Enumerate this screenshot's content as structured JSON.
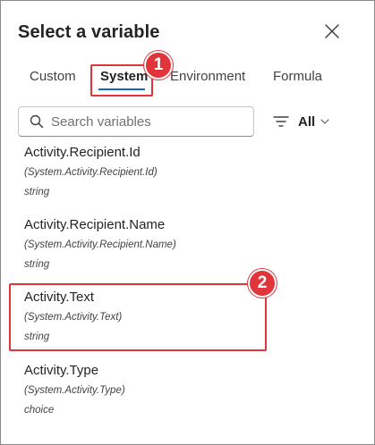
{
  "dialog": {
    "title": "Select a variable"
  },
  "tabs": [
    {
      "label": "Custom",
      "active": false
    },
    {
      "label": "System",
      "active": true
    },
    {
      "label": "Environment",
      "active": false
    },
    {
      "label": "Formula",
      "active": false
    }
  ],
  "search": {
    "placeholder": "Search variables",
    "value": ""
  },
  "filter": {
    "label": "All"
  },
  "variables": [
    {
      "name": "Activity.Recipient.Id",
      "path": "(System.Activity.Recipient.Id)",
      "type": "string"
    },
    {
      "name": "Activity.Recipient.Name",
      "path": "(System.Activity.Recipient.Name)",
      "type": "string"
    },
    {
      "name": "Activity.Text",
      "path": "(System.Activity.Text)",
      "type": "string"
    },
    {
      "name": "Activity.Type",
      "path": "(System.Activity.Type)",
      "type": "choice"
    }
  ],
  "callouts": [
    {
      "number": "1"
    },
    {
      "number": "2"
    }
  ],
  "colors": {
    "callout": "#e0353b",
    "active_tab_underline": "#0f6cbd"
  },
  "icons": {
    "close": "close-icon",
    "search": "search-icon",
    "filter": "filter-icon",
    "chevron": "chevron-down-icon"
  }
}
